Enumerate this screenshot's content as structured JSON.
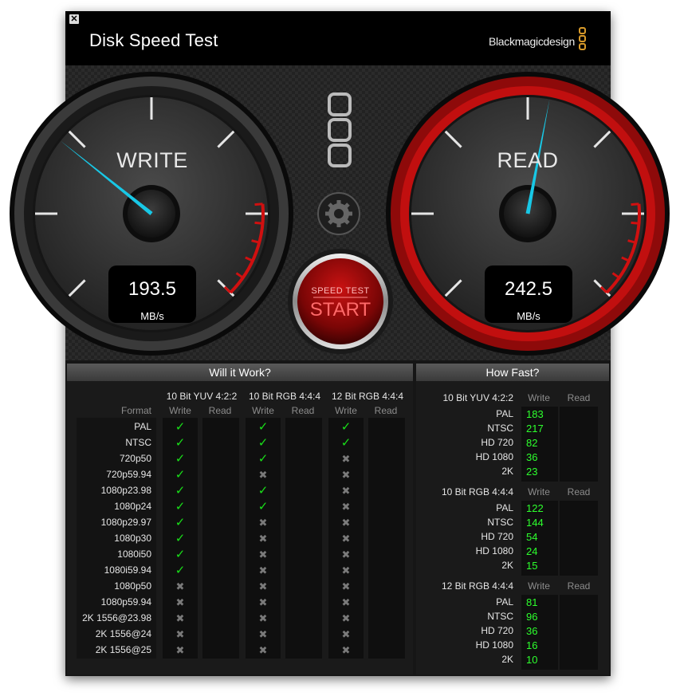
{
  "window": {
    "title": "Disk Speed Test",
    "brand": "Blackmagicdesign",
    "close_glyph": "✕"
  },
  "write_gauge": {
    "label": "WRITE",
    "value": "193.5",
    "unit": "MB/s",
    "needle_fraction": 0.31
  },
  "read_gauge": {
    "label": "READ",
    "value": "242.5",
    "unit": "MB/s",
    "needle_fraction": 0.54
  },
  "start_button": {
    "caption": "SPEED TEST",
    "label": "START"
  },
  "settings": {
    "icon": "gear-icon"
  },
  "will_it_work": {
    "title": "Will it Work?",
    "format_header": "Format",
    "groups": [
      {
        "name": "10 Bit YUV 4:2:2",
        "write": "Write",
        "read": "Read"
      },
      {
        "name": "10 Bit RGB 4:4:4",
        "write": "Write",
        "read": "Read"
      },
      {
        "name": "12 Bit RGB 4:4:4",
        "write": "Write",
        "read": "Read"
      }
    ],
    "formats": [
      "PAL",
      "NTSC",
      "720p50",
      "720p59.94",
      "1080p23.98",
      "1080p24",
      "1080p29.97",
      "1080p30",
      "1080i50",
      "1080i59.94",
      "1080p50",
      "1080p59.94",
      "2K 1556@23.98",
      "2K 1556@24",
      "2K 1556@25"
    ],
    "results": [
      [
        1,
        1,
        1
      ],
      [
        1,
        1,
        1
      ],
      [
        1,
        1,
        0
      ],
      [
        1,
        0,
        0
      ],
      [
        1,
        1,
        0
      ],
      [
        1,
        1,
        0
      ],
      [
        1,
        0,
        0
      ],
      [
        1,
        0,
        0
      ],
      [
        1,
        0,
        0
      ],
      [
        1,
        0,
        0
      ],
      [
        0,
        0,
        0
      ],
      [
        0,
        0,
        0
      ],
      [
        0,
        0,
        0
      ],
      [
        0,
        0,
        0
      ],
      [
        0,
        0,
        0
      ]
    ],
    "check_glyph": "✓",
    "cross_glyph": "✖"
  },
  "how_fast": {
    "title": "How Fast?",
    "write": "Write",
    "read": "Read",
    "groups": [
      {
        "name": "10 Bit YUV 4:2:2",
        "rows": [
          [
            "PAL",
            "183"
          ],
          [
            "NTSC",
            "217"
          ],
          [
            "HD 720",
            "82"
          ],
          [
            "HD 1080",
            "36"
          ],
          [
            "2K",
            "23"
          ]
        ]
      },
      {
        "name": "10 Bit RGB 4:4:4",
        "rows": [
          [
            "PAL",
            "122"
          ],
          [
            "NTSC",
            "144"
          ],
          [
            "HD 720",
            "54"
          ],
          [
            "HD 1080",
            "24"
          ],
          [
            "2K",
            "15"
          ]
        ]
      },
      {
        "name": "12 Bit RGB 4:4:4",
        "rows": [
          [
            "PAL",
            "81"
          ],
          [
            "NTSC",
            "96"
          ],
          [
            "HD 720",
            "36"
          ],
          [
            "HD 1080",
            "16"
          ],
          [
            "2K",
            "10"
          ]
        ]
      }
    ]
  },
  "colors": {
    "needle": "#18c8e6",
    "read_ring": "#b80b0b",
    "ok": "#19e019",
    "number": "#2dff2d"
  }
}
